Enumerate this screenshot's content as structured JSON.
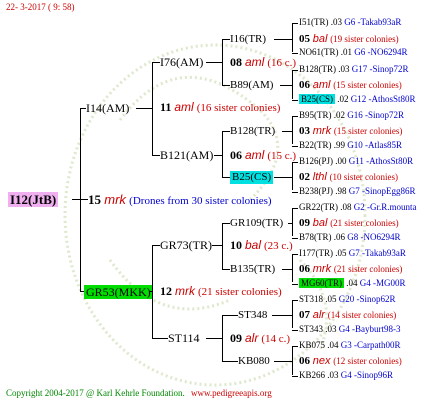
{
  "header": {
    "date": "22-  3-2017 (  9: 58)"
  },
  "footer": {
    "copyright": "Copyright 2004-2017 @ Karl Kehrle Foundation.",
    "url": "www.pedigreeapis.org"
  },
  "colors": {
    "accent_red": "#cc0000",
    "link_blue": "#0000cc",
    "cyan_box": "#00e0e0",
    "green_box": "#00dd00",
    "pink_box": "#f0b0f0"
  },
  "gen1": {
    "name": "I12(JtB)"
  },
  "gen1_year": {
    "num": "15",
    "q": "mrk",
    "sib": "(Drones from 30 sister colonies)"
  },
  "gen2": [
    {
      "name": "I14(AM)",
      "num": "11",
      "q": "aml",
      "sib": "(16 sister colonies)"
    },
    {
      "name": "GR53(MKK)",
      "num": "12",
      "q": "mrk",
      "sib": "(21 sister colonies)"
    }
  ],
  "gen3": [
    {
      "name": "I76(AM)",
      "num": "08",
      "q": "aml",
      "sib": "(16 c.)"
    },
    {
      "name": "B121(AM)",
      "num": "06",
      "q": "aml",
      "sib": "(15 c.)"
    },
    {
      "name": "GR73(TR)",
      "num": "10",
      "q": "bal",
      "sib": "(23 c.)"
    },
    {
      "name": "ST114",
      "num": "09",
      "q": "alr",
      "sib": "(14 c.)"
    }
  ],
  "gen4": [
    {
      "name": "I16(TR)",
      "num": "05",
      "q": "bal",
      "sib": "(19 sister colonies)"
    },
    {
      "name": "B89(AM)",
      "num": "06",
      "q": "aml",
      "sib": "(15 sister colonies)"
    },
    {
      "name": "B128(TR)",
      "num": "03",
      "q": "mrk",
      "sib": "(15 sister colonies)"
    },
    {
      "name": "B25(CS)",
      "num": "02",
      "q": "lthl",
      "sib": "(10 sister colonies)"
    },
    {
      "name": "GR109(TR)",
      "num": "09",
      "q": "bal",
      "sib": "(21 sister colonies)"
    },
    {
      "name": "B135(TR)",
      "num": "06",
      "q": "mrk",
      "sib": "(21 sister colonies)"
    },
    {
      "name": "ST348",
      "num": "07",
      "q": "alr",
      "sib": "(14 sister colonies)"
    },
    {
      "name": "KB080",
      "num": "06",
      "q": "nex",
      "sib": "(12 sister colonies)"
    }
  ],
  "gen5": [
    {
      "name": "I51(TR)",
      "yr": ".03",
      "ref": "G6 -Takab93aR"
    },
    {
      "name": "NO61(TR)",
      "yr": ".01",
      "ref": "G6 -NO6294R"
    },
    {
      "name": "B128(TR)",
      "yr": ".03",
      "ref": "G17 -Sinop72R"
    },
    {
      "name": "B25(CS)",
      "yr": ".02",
      "ref": "G12 -AthosSt80R"
    },
    {
      "name": "B95(TR)",
      "yr": ".02",
      "ref": "G16 -Sinop72R"
    },
    {
      "name": "B22(TR)",
      "yr": ".99",
      "ref": "G10 -Atlas85R"
    },
    {
      "name": "B126(PJ)",
      "yr": ".00",
      "ref": "G11 -AthosSt80R"
    },
    {
      "name": "B238(PJ)",
      "yr": ".98",
      "ref": "G7 -SinopEgg86R"
    },
    {
      "name": "GR22(TR)",
      "yr": ".08",
      "ref": "G2 -Gr.R.mounta"
    },
    {
      "name": "B78(TR)",
      "yr": ".06",
      "ref": "G8 -NO6294R"
    },
    {
      "name": "I177(TR)",
      "yr": ".05",
      "ref": "G7 -Takab93aR"
    },
    {
      "name": "MG60(TR)",
      "yr": ".04",
      "ref": "G4 -MG00R"
    },
    {
      "name": "ST318",
      "yr": ".05",
      "ref": "G20 -Sinop62R"
    },
    {
      "name": "ST343",
      "yr": ".03",
      "ref": "G4 -Bayburt98-3"
    },
    {
      "name": "KB075",
      "yr": ".04",
      "ref": "G3 -Carpath00R"
    },
    {
      "name": "KB266",
      "yr": ".03",
      "ref": "G4 -Sinop96R"
    }
  ]
}
